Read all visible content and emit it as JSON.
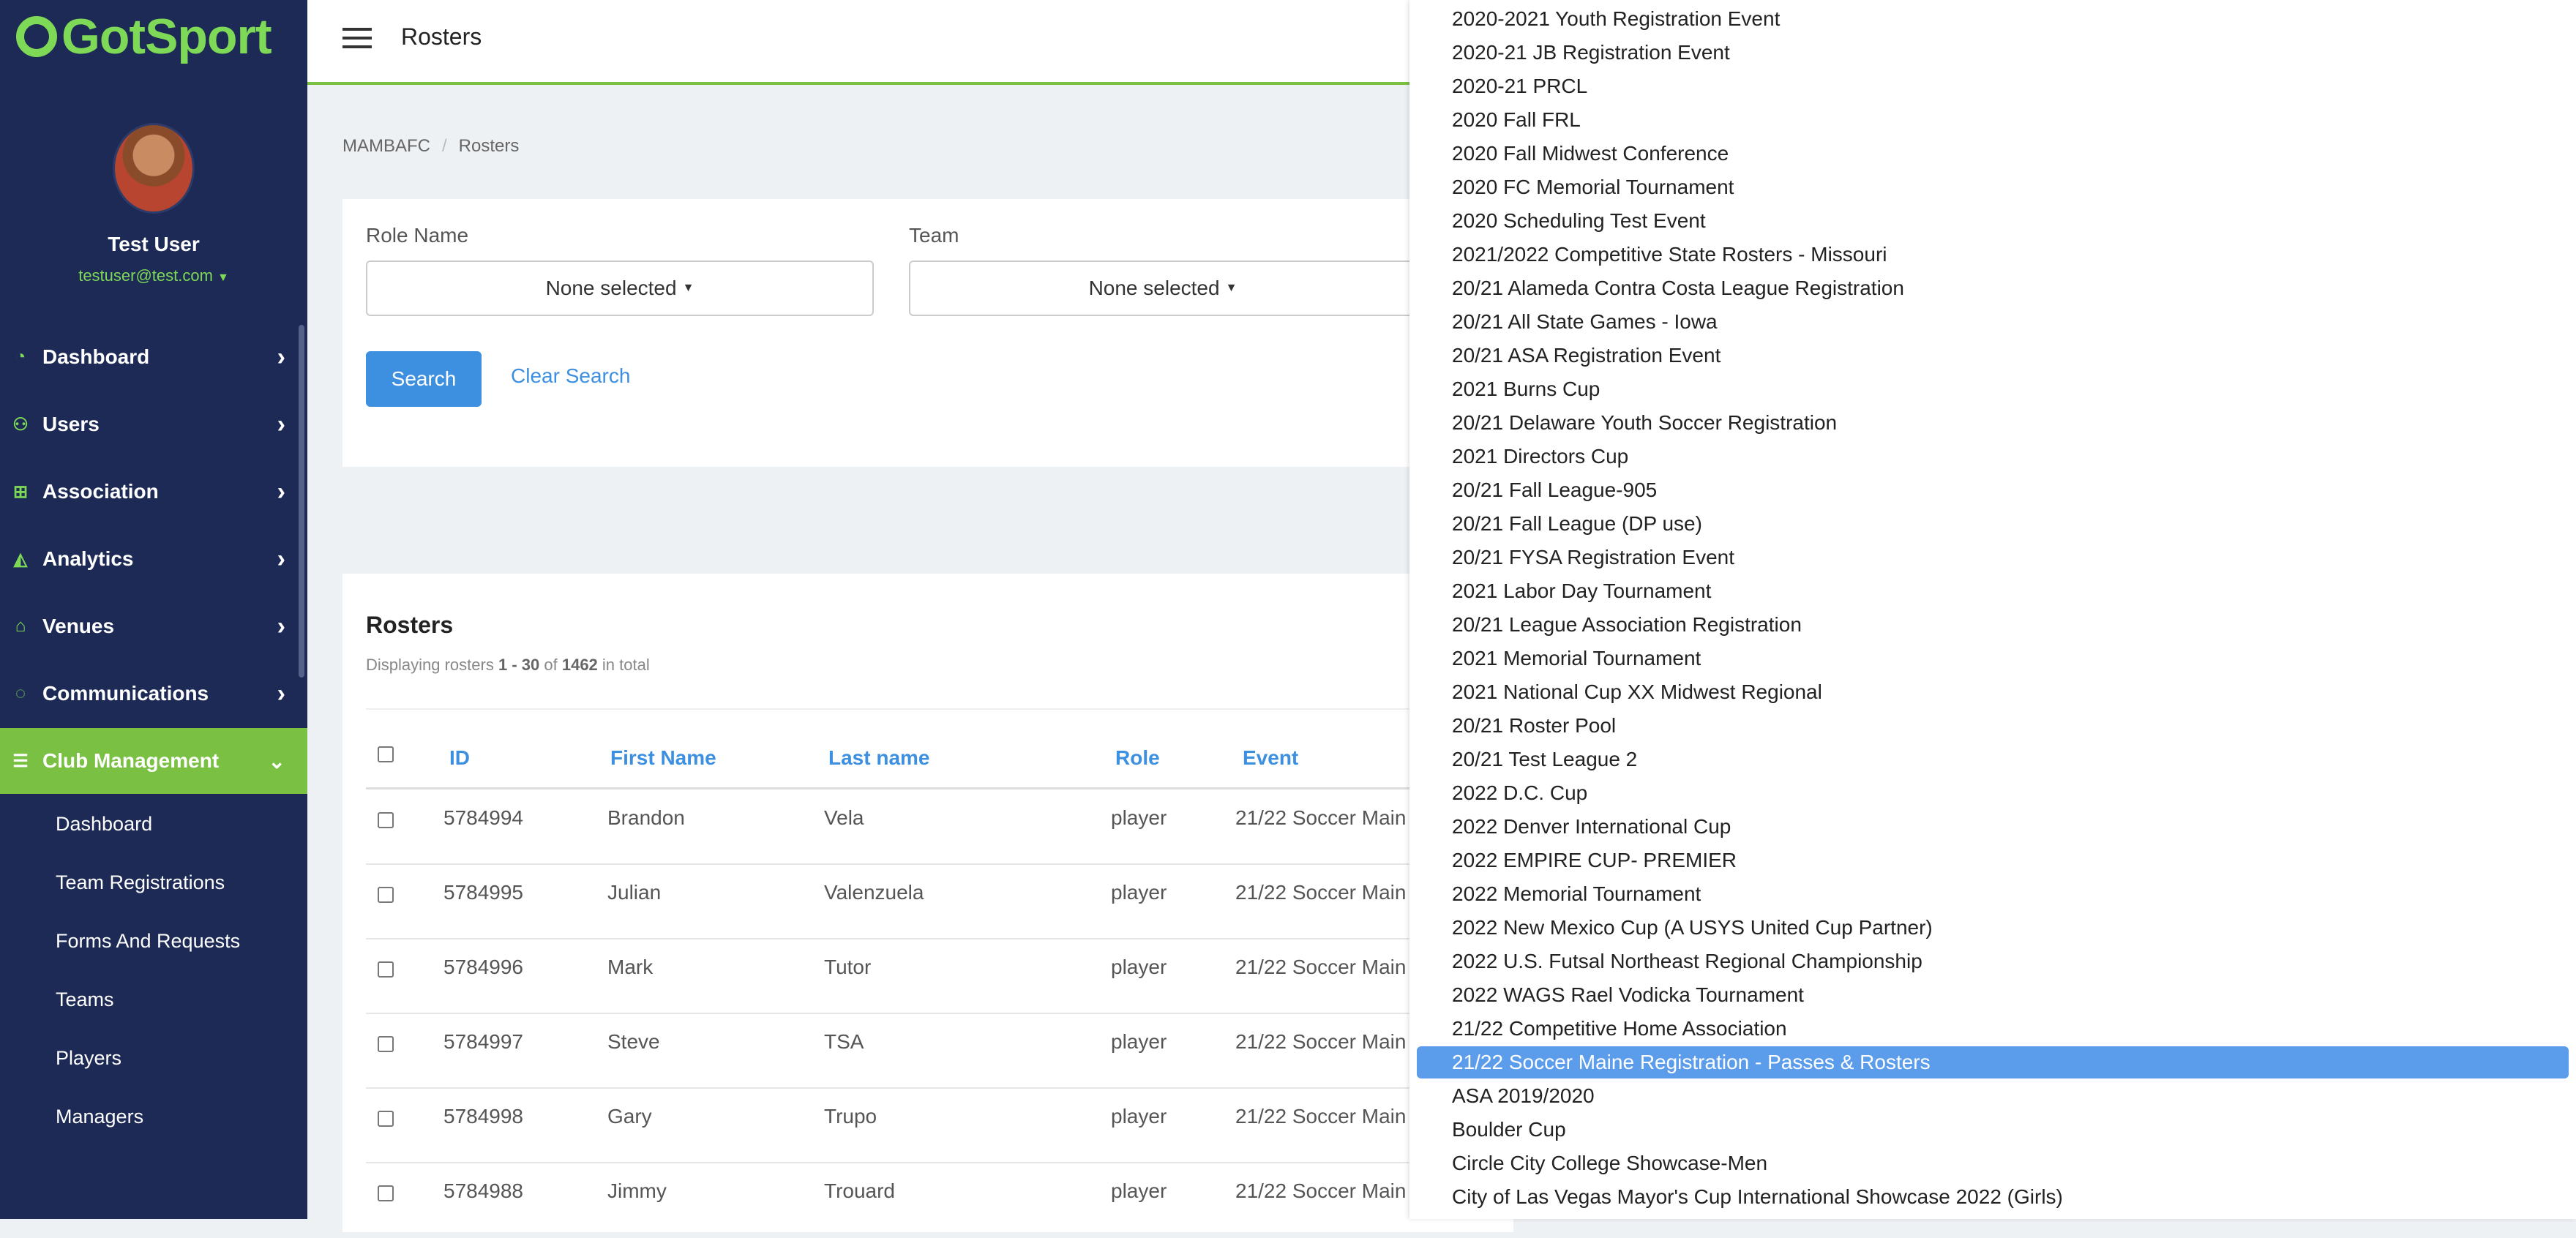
{
  "brand": {
    "name": "GotSport",
    "accent": "#7ac143",
    "sidebar_bg": "#1c2a55",
    "link": "#3d8fe0"
  },
  "user": {
    "name": "Test User",
    "email": "testuser@test.com"
  },
  "sidebar": {
    "items": [
      {
        "label": "Dashboard",
        "icon": "dashboard-icon"
      },
      {
        "label": "Users",
        "icon": "users-icon"
      },
      {
        "label": "Association",
        "icon": "sitemap-icon"
      },
      {
        "label": "Analytics",
        "icon": "area-chart-icon"
      },
      {
        "label": "Venues",
        "icon": "home-icon"
      },
      {
        "label": "Communications",
        "icon": "comments-icon"
      },
      {
        "label": "Club Management",
        "icon": "list-icon",
        "active": true
      }
    ],
    "sub_items": [
      "Dashboard",
      "Team Registrations",
      "Forms And Requests",
      "Teams",
      "Players",
      "Managers"
    ]
  },
  "header": {
    "title": "Rosters"
  },
  "breadcrumb": {
    "root": "MAMBAFC",
    "current": "Rosters"
  },
  "search": {
    "role_label": "Role Name",
    "role_value": "None selected",
    "team_label": "Team",
    "team_value": "None selected",
    "search_button": "Search",
    "clear_link": "Clear Search"
  },
  "rosters": {
    "heading": "Rosters",
    "count_prefix": "Displaying rosters",
    "count_range": "1 - 30",
    "count_of": "of",
    "count_total": "1462",
    "count_suffix": "in total",
    "columns": [
      "ID",
      "First Name",
      "Last name",
      "Role",
      "Event"
    ],
    "rows": [
      {
        "id": "5784994",
        "first": "Brandon",
        "last": "Vela",
        "role": "player",
        "event": "21/22 Soccer Main"
      },
      {
        "id": "5784995",
        "first": "Julian",
        "last": "Valenzuela",
        "role": "player",
        "event": "21/22 Soccer Main"
      },
      {
        "id": "5784996",
        "first": "Mark",
        "last": "Tutor",
        "role": "player",
        "event": "21/22 Soccer Main"
      },
      {
        "id": "5784997",
        "first": "Steve",
        "last": "TSA",
        "role": "player",
        "event": "21/22 Soccer Main"
      },
      {
        "id": "5784998",
        "first": "Gary",
        "last": "Trupo",
        "role": "player",
        "event": "21/22 Soccer Main"
      },
      {
        "id": "5784988",
        "first": "Jimmy",
        "last": "Trouard",
        "role": "player",
        "event": "21/22 Soccer Main"
      }
    ]
  },
  "event_dropdown": {
    "options": [
      "2020-2021 Youth Registration Event",
      "2020-21 JB Registration Event",
      "2020-21 PRCL",
      "2020 Fall FRL",
      "2020 Fall Midwest Conference",
      "2020 FC Memorial Tournament",
      "2020 Scheduling Test Event",
      "2021/2022 Competitive State Rosters - Missouri",
      "20/21 Alameda Contra Costa League Registration",
      "20/21 All State Games - Iowa",
      "20/21 ASA Registration Event",
      "2021 Burns Cup",
      "20/21 Delaware Youth Soccer Registration",
      "2021 Directors Cup",
      "20/21 Fall League-905",
      "20/21 Fall League (DP use)",
      "20/21 FYSA Registration Event",
      "2021 Labor Day Tournament",
      "20/21 League Association Registration",
      "2021 Memorial Tournament",
      "2021 National Cup XX Midwest Regional",
      "20/21 Roster Pool",
      "20/21 Test League 2",
      "2022 D.C. Cup",
      "2022 Denver International Cup",
      "2022 EMPIRE CUP- PREMIER",
      "2022 Memorial Tournament",
      "2022 New Mexico Cup (A USYS United Cup Partner)",
      "2022 U.S. Futsal Northeast Regional Championship",
      "2022 WAGS Rael Vodicka Tournament",
      "21/22 Competitive Home Association",
      "21/22 Soccer Maine Registration - Passes & Rosters",
      "ASA 2019/2020",
      "Boulder Cup",
      "Circle City College Showcase-Men",
      "City of Las Vegas Mayor's Cup International Showcase 2022 (Girls)"
    ],
    "selected_index": 31
  }
}
